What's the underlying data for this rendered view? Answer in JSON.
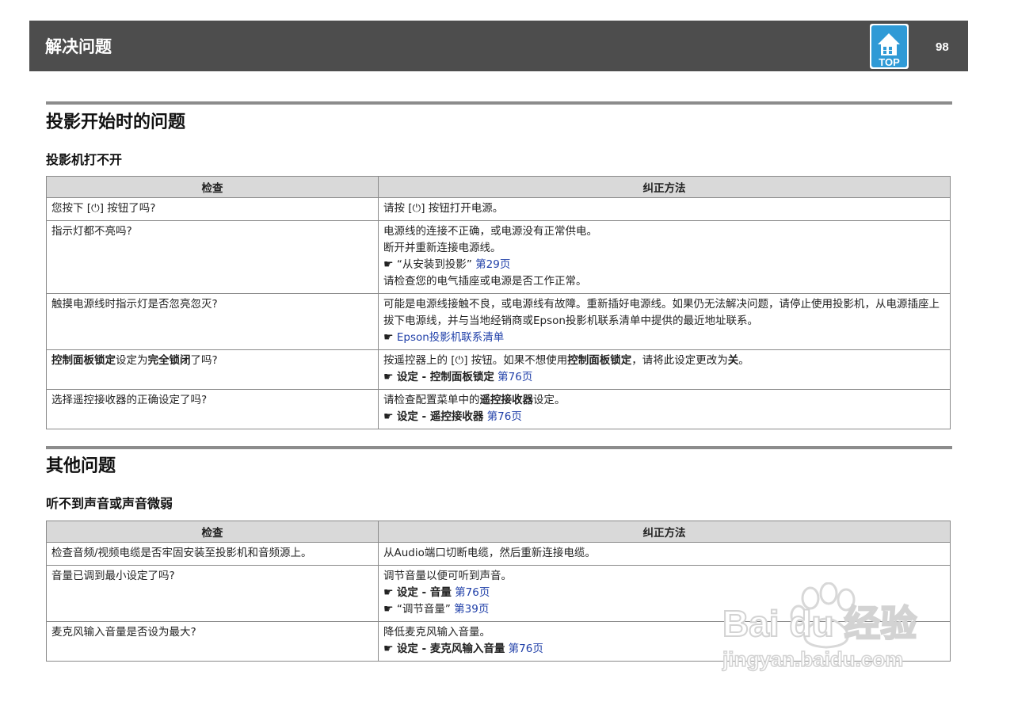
{
  "header": {
    "title": "解决问题",
    "top_label": "TOP",
    "page_number": "98"
  },
  "section1": {
    "title": "投影开始时的问题",
    "subtitle": "投影机打不开",
    "col_check": "检查",
    "col_fix": "纠正方法",
    "rows": [
      {
        "check": "您按下 [⏻] 按钮了吗?",
        "fix": [
          "请按 [⏻] 按钮打开电源。"
        ]
      },
      {
        "check": "指示灯都不亮吗?",
        "fix": [
          "电源线的连接不正确，或电源没有正常供电。",
          "断开并重新连接电源线。"
        ],
        "ref": {
          "pointer": "☛",
          "text": "“从安装到投影”",
          "link": "第29页"
        },
        "fix_after": "请检查您的电气插座或电源是否工作正常。"
      },
      {
        "check": "触摸电源线时指示灯是否忽亮忽灭?",
        "fix": [
          "可能是电源线接触不良，或电源线有故障。重新插好电源线。如果仍无法解决问题，请停止使用投影机，从电源插座上拔下电源线，并与当地经销商或Epson投影机联系清单中提供的最近地址联系。"
        ],
        "ref": {
          "pointer": "☛",
          "link": "Epson投影机联系清单"
        }
      },
      {
        "check_parts": [
          "控制面板锁定",
          "设定为",
          "完全锁闭",
          "了吗?"
        ],
        "fix_parts": [
          "按遥控器上的 [⏻] 按钮。如果不想使用",
          "控制面板锁定",
          "，请将此设定更改为",
          "关",
          "。"
        ],
        "ref": {
          "pointer": "☛",
          "text": "设定 - 控制面板锁定",
          "link": "第76页"
        }
      },
      {
        "check": "选择遥控接收器的正确设定了吗?",
        "fix_parts": [
          "请检查配置菜单中的",
          "遥控接收器",
          "设定。"
        ],
        "ref": {
          "pointer": "☛",
          "text": "设定 - 遥控接收器",
          "link": "第76页"
        }
      }
    ]
  },
  "section2": {
    "title": "其他问题",
    "subtitle": "听不到声音或声音微弱",
    "col_check": "检查",
    "col_fix": "纠正方法",
    "rows": [
      {
        "check": "检查音频/视频电缆是否牢固安装至投影机和音频源上。",
        "fix": "从Audio端口切断电缆，然后重新连接电缆。"
      },
      {
        "check": "音量已调到最小设定了吗?",
        "fix": "调节音量以便可听到声音。",
        "ref1": {
          "pointer": "☛",
          "text": "设定 - 音量",
          "link": "第76页"
        },
        "ref2": {
          "pointer": "☛",
          "text": "“调节音量”",
          "link": "第39页"
        }
      },
      {
        "check": "麦克风输入音量是否设为最大?",
        "fix": "降低麦克风输入音量。",
        "ref": {
          "pointer": "☛",
          "text": "设定 - 麦克风输入音量",
          "link": "第76页"
        }
      }
    ]
  },
  "watermark": {
    "brand": "Bai du 经验",
    "url": "jingyan.baidu.com"
  }
}
